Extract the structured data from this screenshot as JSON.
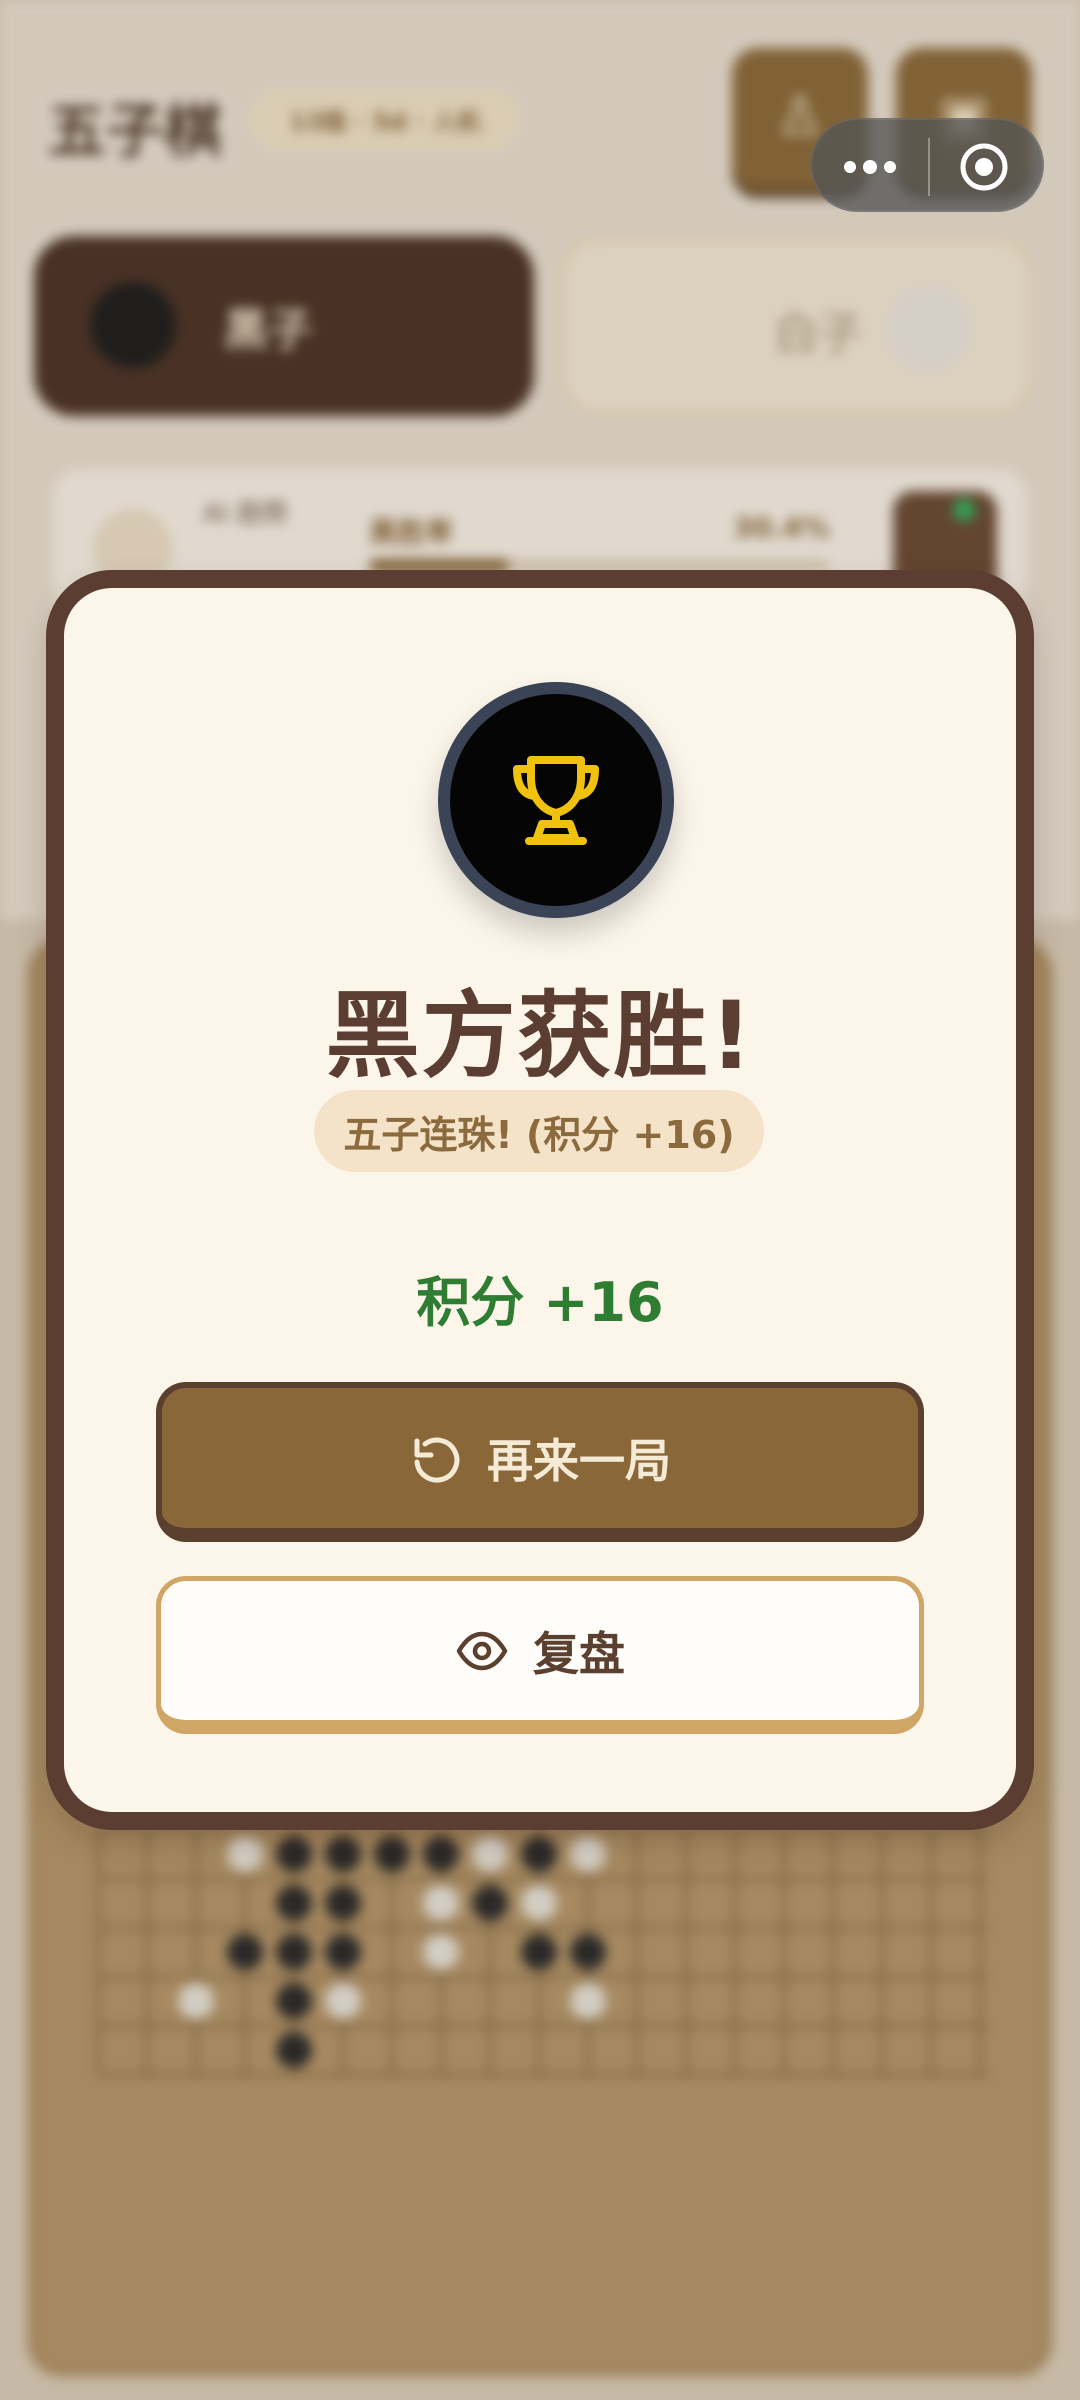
{
  "background": {
    "app_title": "五子棋",
    "mode_pill": "13路 · 5d · 人机",
    "players": {
      "black_label": "黑子",
      "white_label": "白子"
    },
    "stats": {
      "ai_label": "AI 趋势",
      "win_rate_label": "黑胜率",
      "win_rate_value": "30.4%",
      "win_rate_fraction": 0.304
    }
  },
  "result": {
    "title": "黑方获胜!",
    "reason": "五子连珠! (积分 +16)",
    "score_delta": "积分 +16",
    "play_again_label": "再来一局",
    "review_label": "复盘"
  },
  "icons": {
    "trophy": "trophy-icon",
    "replay": "replay-icon",
    "eye": "eye-icon",
    "more": "more-dots-icon",
    "close": "mini-program-close-icon"
  },
  "colors": {
    "modal_border": "#5c3d31",
    "modal_bg": "#fbf5ea",
    "trophy_gold": "#f0c20f",
    "success_green": "#2f7d32",
    "primary_button": "#8a6738",
    "secondary_border": "#d0a666"
  }
}
